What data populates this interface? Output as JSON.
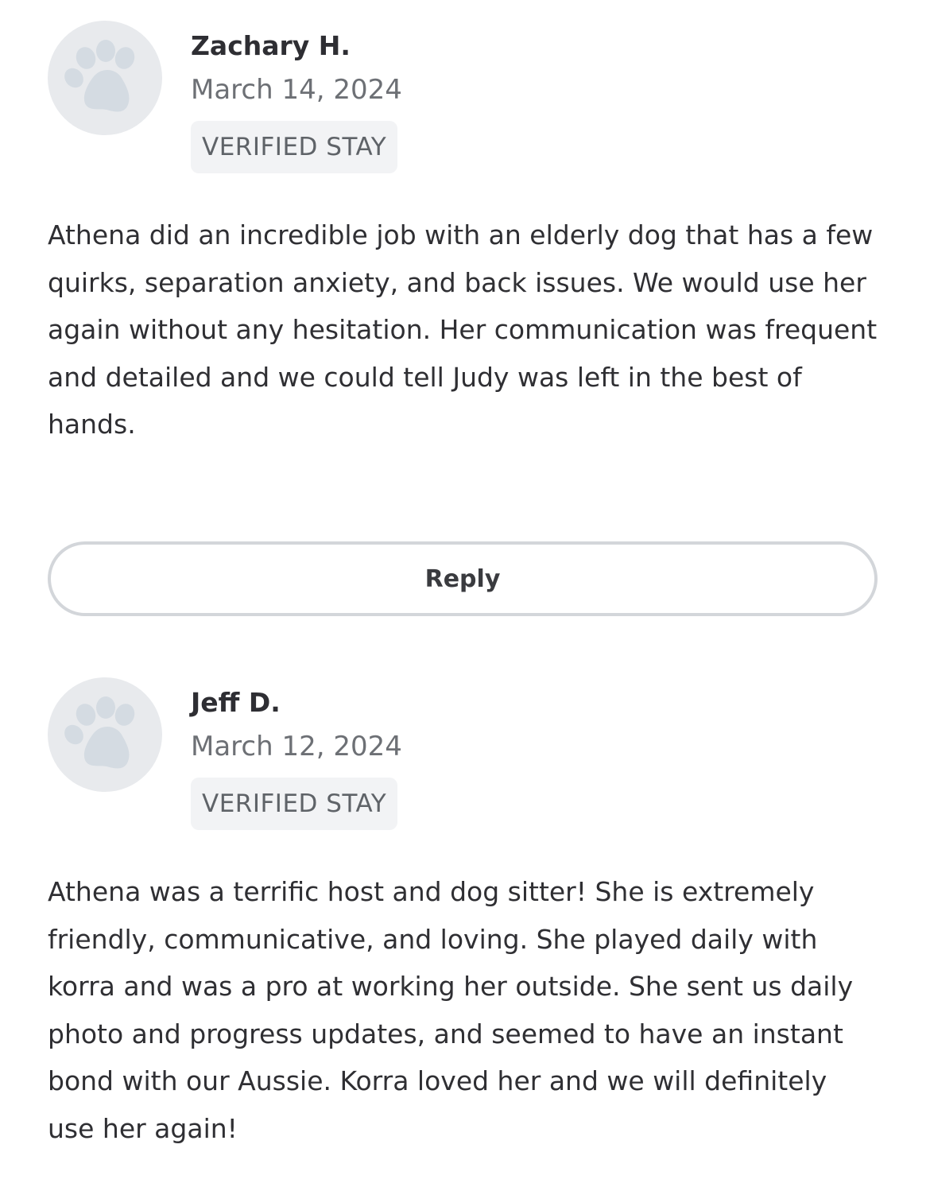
{
  "colors": {
    "avatar_bg": "#e8eaed",
    "paw": "#d4dbe2",
    "badge_bg": "#f2f3f5",
    "reply_border": "#d3d6da",
    "text": "#2f2f33",
    "muted_text": "#6d7075"
  },
  "reviews": [
    {
      "avatar_icon": "paw-print-icon",
      "name": "Zachary H.",
      "date": "March 14, 2024",
      "badge": "VERIFIED STAY",
      "text": "Athena did an incredible job with an elderly dog that has a few quirks, separation anxiety, and back issues. We would use her again without any hesitation. Her communication was frequent and detailed and we could tell Judy was left in the best of hands."
    },
    {
      "avatar_icon": "paw-print-icon",
      "name": "Jeff D.",
      "date": "March 12, 2024",
      "badge": "VERIFIED STAY",
      "text": "Athena was a terrific host and dog sitter! She is extremely friendly, communicative, and loving. She played daily with korra and was a pro at working her outside. She sent us daily photo and progress updates, and seemed to have an instant bond with our Aussie. Korra loved her and we will definitely use her again!"
    }
  ],
  "reply_button": {
    "label": "Reply"
  }
}
